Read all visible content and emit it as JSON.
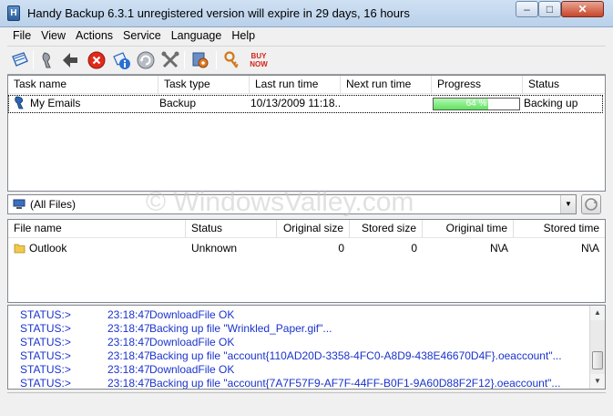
{
  "window": {
    "title": "Handy Backup 6.3.1 unregistered version will expire in 29 days, 16 hours",
    "min_glyph": "‒",
    "max_glyph": "□",
    "close_glyph": "✕"
  },
  "menu": [
    "File",
    "View",
    "Actions",
    "Service",
    "Language",
    "Help"
  ],
  "toolbar": {
    "icons": [
      "open-task-icon",
      "task-wizard-icon",
      "back-icon",
      "stop-icon",
      "info-icon",
      "refresh-icon",
      "tools-icon",
      "settings-icon",
      "key-icon",
      "buy-now-icon"
    ],
    "buy_now_label": "BUY NOW"
  },
  "task_table": {
    "columns": [
      "Task name",
      "Task type",
      "Last run time",
      "Next run time",
      "Progress",
      "Status"
    ],
    "rows": [
      {
        "name": "My Emails",
        "type": "Backup",
        "last_run": "10/13/2009 11:18...",
        "next_run": "",
        "progress_percent": 64,
        "progress_label": "64 %",
        "status": "Backing up"
      }
    ]
  },
  "filter": {
    "selected": "(All Files)"
  },
  "file_table": {
    "columns": [
      "File name",
      "Status",
      "Original size",
      "Stored size",
      "Original time",
      "Stored time"
    ],
    "rows": [
      {
        "name": "Outlook",
        "status": "Unknown",
        "original_size": "0",
        "stored_size": "0",
        "original_time": "N\\A",
        "stored_time": "N\\A"
      }
    ]
  },
  "log": [
    {
      "key": "STATUS:>",
      "time": "23:18:47",
      "message": "DownloadFile OK"
    },
    {
      "key": "STATUS:>",
      "time": "23:18:47",
      "message": "Backing up file \"Wrinkled_Paper.gif\"..."
    },
    {
      "key": "STATUS:>",
      "time": "23:18:47",
      "message": "DownloadFile OK"
    },
    {
      "key": "STATUS:>",
      "time": "23:18:47",
      "message": "Backing up file \"account{110AD20D-3358-4FC0-A8D9-438E46670D4F}.oeaccount\"..."
    },
    {
      "key": "STATUS:>",
      "time": "23:18:47",
      "message": "DownloadFile OK"
    },
    {
      "key": "STATUS:>",
      "time": "23:18:47",
      "message": "Backing up file \"account{7A7F57F9-AF7F-44FF-B0F1-9A60D88F2F12}.oeaccount\"..."
    }
  ],
  "watermark": "© WindowsValley.com",
  "colors": {
    "progress": "#5ee35e",
    "log_text": "#1a33cc",
    "close_button": "#c8452a"
  }
}
